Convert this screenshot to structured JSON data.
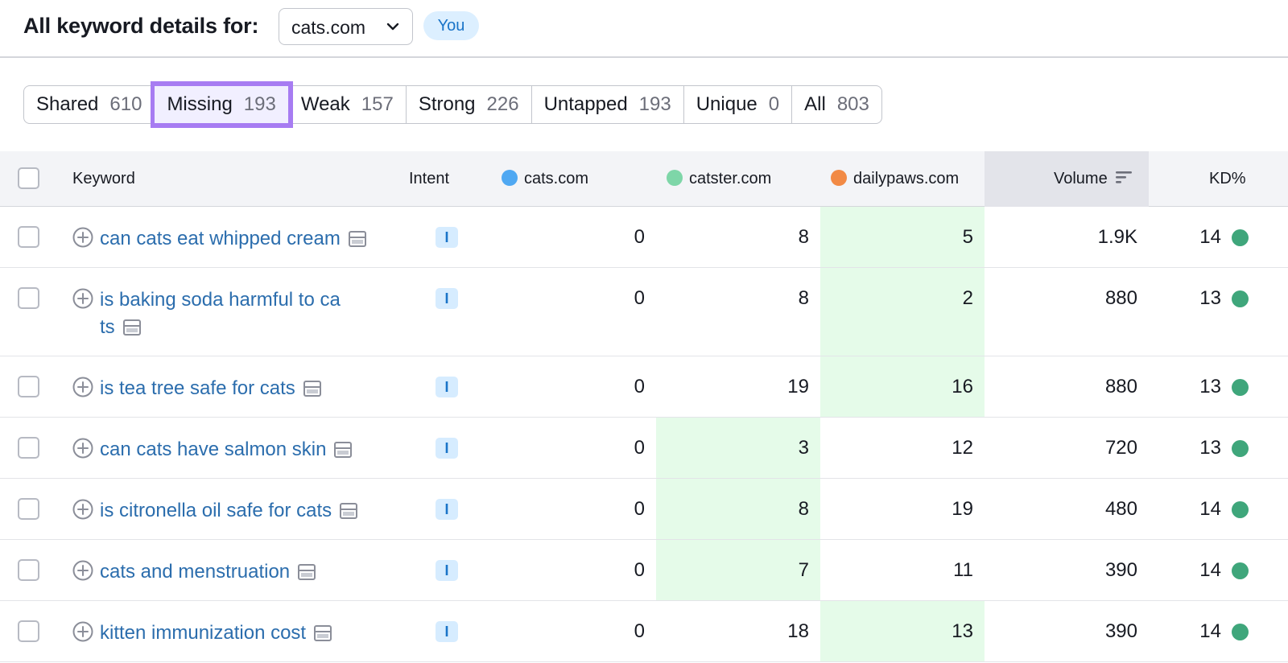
{
  "header": {
    "title": "All keyword details for:",
    "domain_value": "cats.com",
    "you_badge": "You"
  },
  "tabs": [
    {
      "label": "Shared",
      "count": "610",
      "active": false
    },
    {
      "label": "Missing",
      "count": "193",
      "active": true
    },
    {
      "label": "Weak",
      "count": "157",
      "active": false
    },
    {
      "label": "Strong",
      "count": "226",
      "active": false
    },
    {
      "label": "Untapped",
      "count": "193",
      "active": false
    },
    {
      "label": "Unique",
      "count": "0",
      "active": false
    },
    {
      "label": "All",
      "count": "803",
      "active": false
    }
  ],
  "table": {
    "columns": {
      "keyword": "Keyword",
      "intent": "Intent",
      "domain1": "cats.com",
      "domain2": "catster.com",
      "domain3": "dailypaws.com",
      "volume": "Volume",
      "kd": "KD%"
    },
    "colors": {
      "domain1": "#4fa8f2",
      "domain2": "#7ed6a8",
      "domain3": "#f28a45",
      "kd_easy": "#3fa67b",
      "best_rank_highlight": "#e5fbe9"
    },
    "rows": [
      {
        "keyword": "can cats eat whipped cream",
        "intent": "I",
        "cats": "0",
        "catster": "8",
        "dailypaws": "5",
        "volume": "1.9K",
        "kd": "14",
        "best": "dailypaws"
      },
      {
        "keyword": "is baking soda harmful to ca",
        "keyword_line2": "ts",
        "intent": "I",
        "cats": "0",
        "catster": "8",
        "dailypaws": "2",
        "volume": "880",
        "kd": "13",
        "best": "dailypaws"
      },
      {
        "keyword": "is tea tree safe for cats",
        "intent": "I",
        "cats": "0",
        "catster": "19",
        "dailypaws": "16",
        "volume": "880",
        "kd": "13",
        "best": "dailypaws"
      },
      {
        "keyword": "can cats have salmon skin",
        "intent": "I",
        "cats": "0",
        "catster": "3",
        "dailypaws": "12",
        "volume": "720",
        "kd": "13",
        "best": "catster"
      },
      {
        "keyword": "is citronella oil safe for cats",
        "intent": "I",
        "cats": "0",
        "catster": "8",
        "dailypaws": "19",
        "volume": "480",
        "kd": "14",
        "best": "catster"
      },
      {
        "keyword": "cats and menstruation",
        "intent": "I",
        "cats": "0",
        "catster": "7",
        "dailypaws": "11",
        "volume": "390",
        "kd": "14",
        "best": "catster"
      },
      {
        "keyword": "kitten immunization cost",
        "intent": "I",
        "cats": "0",
        "catster": "18",
        "dailypaws": "13",
        "volume": "390",
        "kd": "14",
        "best": "dailypaws"
      }
    ]
  }
}
